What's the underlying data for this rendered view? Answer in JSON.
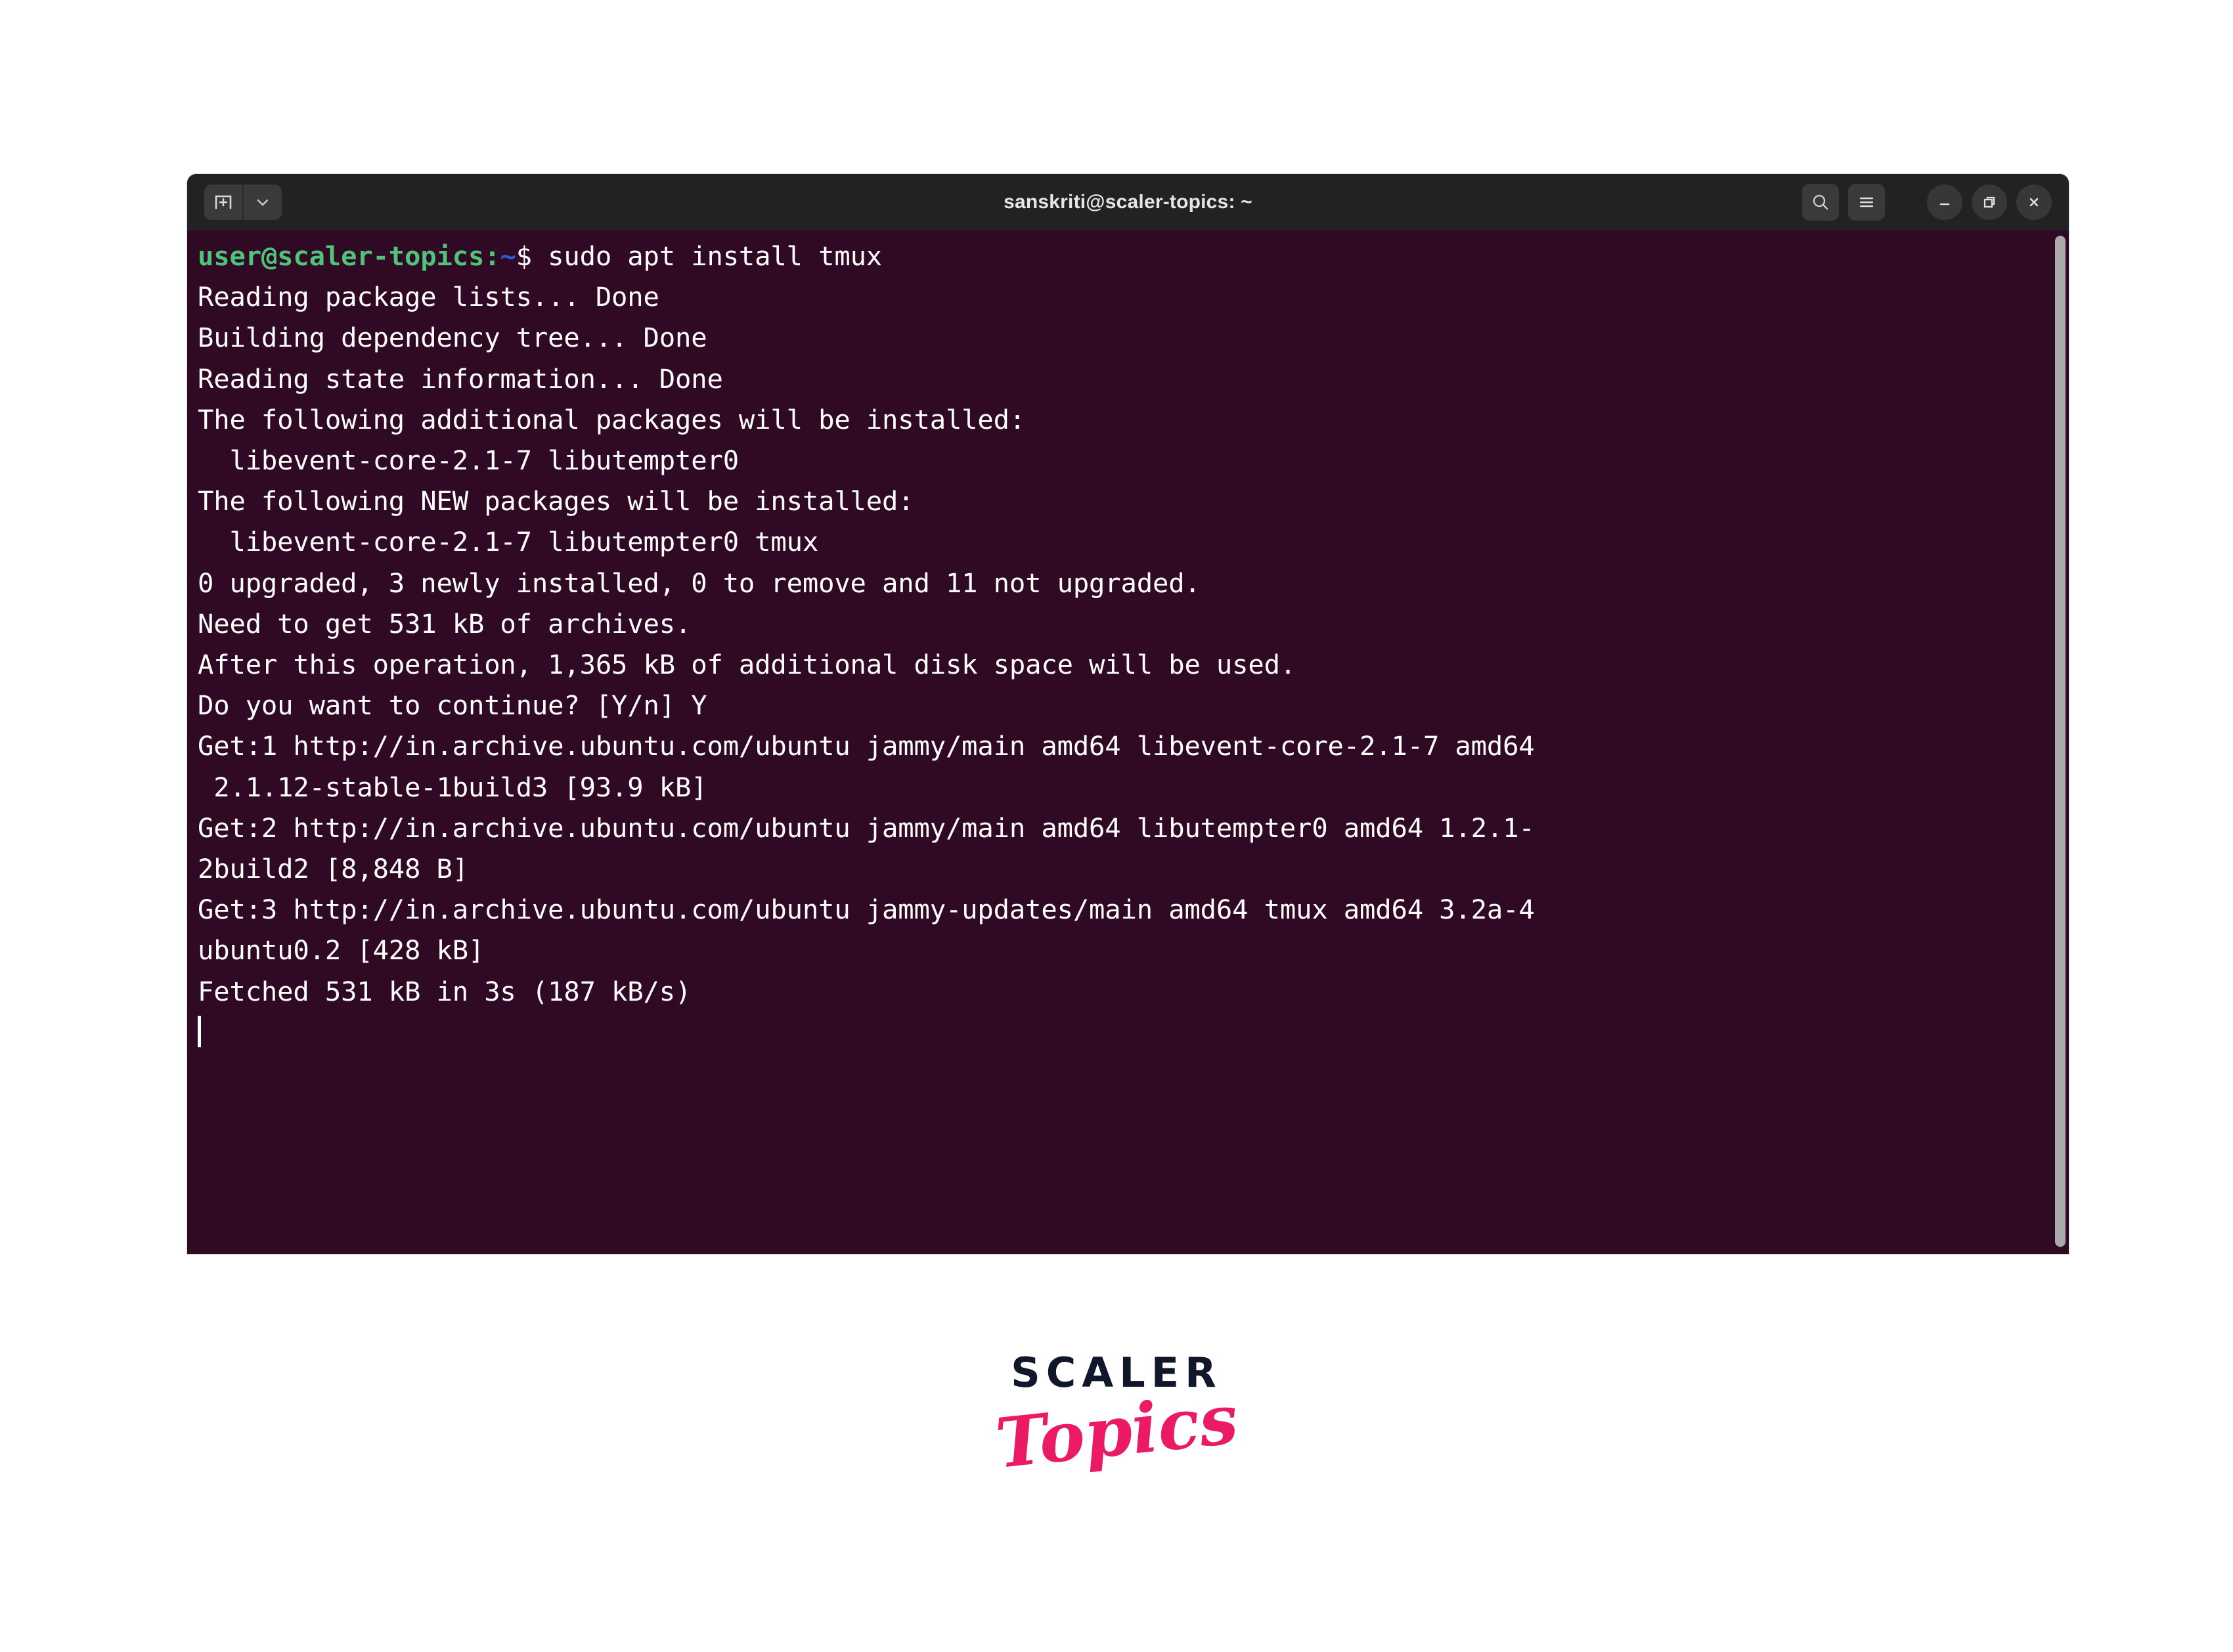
{
  "window": {
    "title": "sanskriti@scaler-topics: ~",
    "titlebar_bg": "#222222",
    "terminal_bg": "#300a24",
    "new_tab_label": "+",
    "tab_dropdown_label": "v",
    "icons": {
      "new_tab": "new-tab-icon",
      "tab_dropdown": "chevron-down-icon",
      "search": "search-icon",
      "menu": "hamburger-menu-icon",
      "minimize": "minimize-icon",
      "maximize": "maximize-icon",
      "close": "close-icon"
    }
  },
  "terminal": {
    "prompt": {
      "user_host": "user@scaler-topics",
      "colon": ":",
      "path": "~",
      "sigil": "$ ",
      "command": "sudo apt install tmux"
    },
    "colors": {
      "prompt_user": "#4ec47a",
      "prompt_path": "#2a5fd9",
      "text": "#ffffff"
    },
    "output_lines": [
      "Reading package lists... Done",
      "Building dependency tree... Done",
      "Reading state information... Done",
      "The following additional packages will be installed:",
      "  libevent-core-2.1-7 libutempter0",
      "The following NEW packages will be installed:",
      "  libevent-core-2.1-7 libutempter0 tmux",
      "0 upgraded, 3 newly installed, 0 to remove and 11 not upgraded.",
      "Need to get 531 kB of archives.",
      "After this operation, 1,365 kB of additional disk space will be used.",
      "Do you want to continue? [Y/n] Y",
      "Get:1 http://in.archive.ubuntu.com/ubuntu jammy/main amd64 libevent-core-2.1-7 amd64",
      " 2.1.12-stable-1build3 [93.9 kB]",
      "Get:2 http://in.archive.ubuntu.com/ubuntu jammy/main amd64 libutempter0 amd64 1.2.1-",
      "2build2 [8,848 B]",
      "Get:3 http://in.archive.ubuntu.com/ubuntu jammy-updates/main amd64 tmux amd64 3.2a-4",
      "ubuntu0.2 [428 kB]",
      "Fetched 531 kB in 3s (187 kB/s)"
    ]
  },
  "logo": {
    "primary": "SCALER",
    "secondary": "Topics",
    "primary_color": "#11172b",
    "secondary_color": "#ea1a65"
  }
}
